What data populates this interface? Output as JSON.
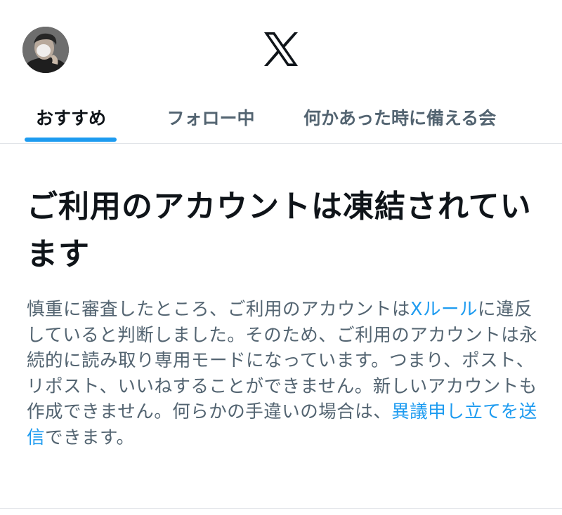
{
  "header": {
    "logo_icon": "x-logo-icon",
    "avatar_icon": "profile-avatar"
  },
  "tabs": [
    {
      "label": "おすすめ",
      "active": true
    },
    {
      "label": "フォロー中",
      "active": false
    },
    {
      "label": "何かあった時に備える会",
      "active": false
    }
  ],
  "notice": {
    "headline": "ご利用のアカウントは凍結されています",
    "body_part1": "慎重に審査したところ、ご利用のアカウントは",
    "rules_link": "Xルール",
    "body_part2": "に違反していると判断しました。そのため、ご利用のアカウントは永続的に読み取り専用モードになっています。つまり、ポスト、リポスト、いいねすることができません。新しいアカウントも作成できません。何らかの手違いの場合は、",
    "appeal_link": "異議申し立てを送信",
    "body_part3": "できます。"
  },
  "colors": {
    "accent": "#1d9bf0",
    "text_primary": "#0f1419",
    "text_secondary": "#536471",
    "divider": "#e1e4e8"
  }
}
